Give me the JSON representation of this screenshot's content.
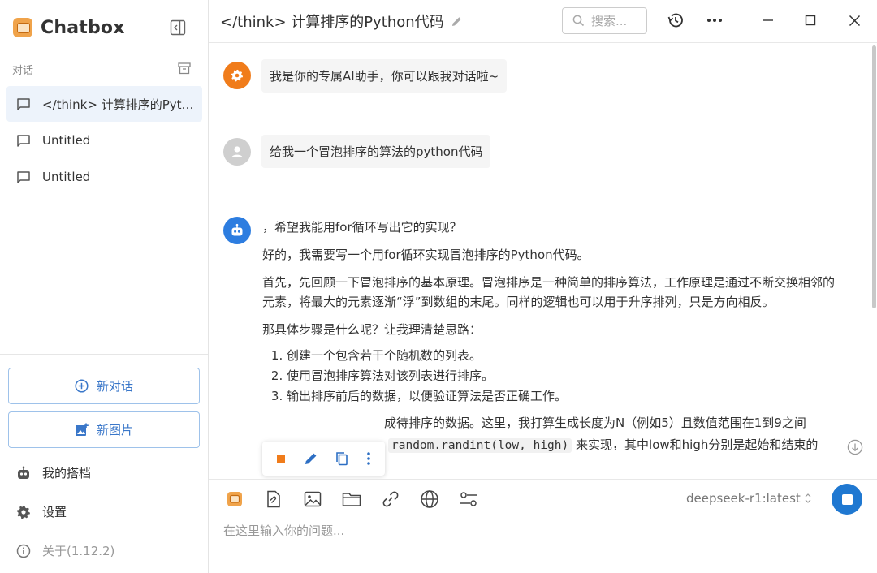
{
  "app": {
    "name": "Chatbox"
  },
  "sidebar": {
    "section_label": "对话",
    "conversations": [
      {
        "label": "</think> 计算排序的Python代码",
        "active": true
      },
      {
        "label": "Untitled",
        "active": false
      },
      {
        "label": "Untitled",
        "active": false
      }
    ],
    "new_chat_label": "新对话",
    "new_image_label": "新图片",
    "partner_label": "我的搭档",
    "settings_label": "设置",
    "about_label": "关于(1.12.2)"
  },
  "header": {
    "title": "</think> 计算排序的Python代码",
    "search_placeholder": "搜索..."
  },
  "messages": {
    "system": "我是你的专属AI助手，你可以跟我对话啦~",
    "user": "给我一个冒泡排序的算法的python代码",
    "assistant": {
      "line1": "，希望我能用for循环写出它的实现？",
      "line2": "好的，我需要写一个用for循环实现冒泡排序的Python代码。",
      "para3": "首先，先回顾一下冒泡排序的基本原理。冒泡排序是一种简单的排序算法，工作原理是通过不断交换相邻的元素，将最大的元素逐渐“浮”到数组的末尾。同样的逻辑也可以用于升序排列，只是方向相反。",
      "para4": "那具体步骤是什么呢？让我理清楚思路：",
      "steps": [
        "创建一个包含若干个随机数的列表。",
        "使用冒泡排序算法对该列表进行排序。",
        "输出排序前后的数据，以便验证算法是否正确工作。"
      ],
      "para5_visible": "成待排序的数据。这里，我打算生成长度为N（例如5）且数值范围在1到9之间",
      "para6_code": "random.randint(low, high)",
      "para6_rest": "来实现，其中low和high分别是起始和结束的"
    }
  },
  "input": {
    "model": "deepseek-r1:latest",
    "placeholder": "在这里输入你的问题..."
  },
  "colors": {
    "accent": "#1f78d1",
    "system_avatar": "#f07c1b",
    "assistant_avatar": "#2d7de0",
    "user_avatar": "#cfcfcf"
  }
}
